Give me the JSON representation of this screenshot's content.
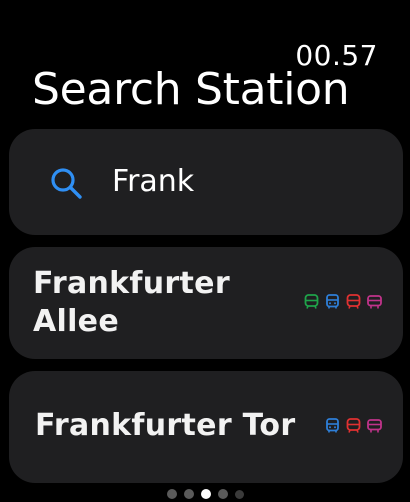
{
  "status": {
    "time": "00.57"
  },
  "header": {
    "title": "Search Station"
  },
  "search": {
    "query": "Frank",
    "icon": "search-icon",
    "icon_color": "#2f8ff4"
  },
  "results": [
    {
      "name_line1": "Frankfurter",
      "name_line2": "Allee",
      "lines": [
        {
          "icon": "tram-icon",
          "color": "#1fa34a"
        },
        {
          "icon": "bus-icon",
          "color": "#2e7fd8"
        },
        {
          "icon": "tram-icon",
          "color": "#e03131"
        },
        {
          "icon": "bus-icon",
          "color": "#c0338a"
        }
      ]
    },
    {
      "name": "Frankfurter Tor",
      "lines": [
        {
          "icon": "bus-icon",
          "color": "#2e7fd8"
        },
        {
          "icon": "tram-icon",
          "color": "#e03131"
        },
        {
          "icon": "bus-icon",
          "color": "#c0338a"
        }
      ]
    }
  ],
  "pagination": {
    "count": 5,
    "active_index": 2
  }
}
